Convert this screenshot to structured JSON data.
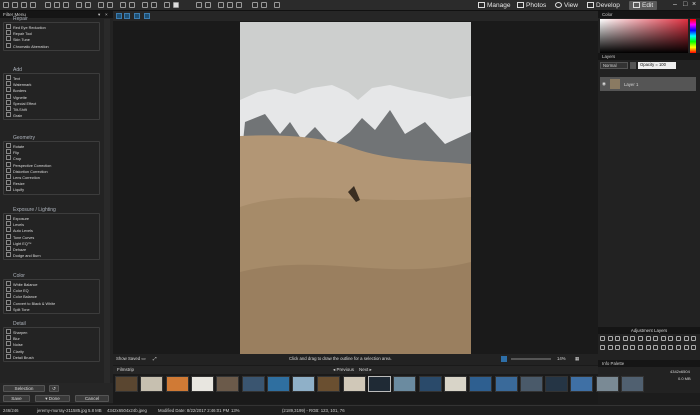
{
  "topbar": {
    "manage": "Manage",
    "photos": "Photos",
    "view": "View",
    "develop": "Develop",
    "edit": "Edit"
  },
  "left_panel": {
    "title": "Filter Menu",
    "sections": [
      {
        "title": "Repair",
        "items": [
          "Red Eye Reduction",
          "Repair Tool",
          "Skin Tune",
          "Chromatic Aberration"
        ]
      },
      {
        "title": "Add",
        "items": [
          "Text",
          "Watermark",
          "Borders",
          "Vignette",
          "Special Effect",
          "Tilt-Shift",
          "Grain"
        ]
      },
      {
        "title": "Geometry",
        "items": [
          "Rotate",
          "Flip",
          "Crop",
          "Perspective Correction",
          "Distortion Correction",
          "Lens Correction",
          "Resize",
          "Liquify"
        ]
      },
      {
        "title": "Exposure / Lighting",
        "items": [
          "Exposure",
          "Levels",
          "Auto Levels",
          "Tone Curves",
          "Light EQ™",
          "Dehaze",
          "Dodge and Burn"
        ]
      },
      {
        "title": "Color",
        "items": [
          "White Balance",
          "Color EQ",
          "Color Balance",
          "Convert to Black & White",
          "Split Tone"
        ]
      },
      {
        "title": "Detail",
        "items": [
          "Sharpen",
          "Blur",
          "Noise",
          "Clarity",
          "Detail Brush"
        ]
      }
    ],
    "selection_label": "Selection",
    "save_label": "Save",
    "done_label": "Done",
    "cancel_label": "Cancel"
  },
  "canvas": {
    "show_saved": "Show Saved",
    "hint": "Click and drag to draw the outline for a selection area.",
    "zoom": "14%",
    "photo_colors": {
      "sky": "#cfd1d0",
      "mountain": "#e8e9ea",
      "dune": "#a88d6b"
    }
  },
  "filmstrip": {
    "title": "Filmstrip",
    "prev_label": "Previous",
    "next_label": "Next"
  },
  "right_panel": {
    "color_title": "Color",
    "layers_title": "Layers",
    "blend_mode": "Normal",
    "opacity": "Opacity = 100",
    "layer_name": "Layer 1",
    "adjustment_layers": "Adjustment Layers",
    "info_title": "Info Palette",
    "info_dims": "4342x6504",
    "info_size": "0.0 MB"
  },
  "statusbar": {
    "index": "246/246",
    "file": "jeremy-murray-211585.jpg",
    "size": "5.8 MB",
    "dims": "4342x6504x24b.jpeg",
    "modified": "Modified Date: 8/22/2017 2:46:01 PM",
    "zoom": "13%",
    "coords": "(2189,3199) - RGB: 123, 101, 76"
  }
}
